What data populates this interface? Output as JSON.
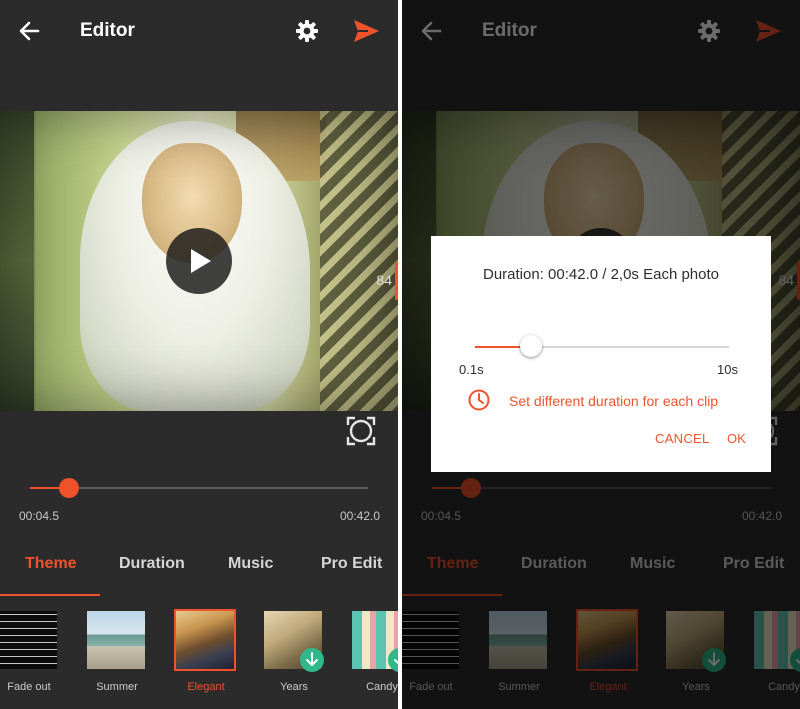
{
  "app": {
    "title": "Editor",
    "accent_color": "#f0522b",
    "background_color": "#2b2b2b",
    "icons": {
      "back": "arrow-left-icon",
      "settings": "gear-icon",
      "share": "send-icon",
      "play": "play-icon",
      "crop": "crop-frame-icon",
      "download": "download-icon",
      "clock": "clock-icon"
    }
  },
  "preview": {
    "side_counter": "84"
  },
  "timeline": {
    "current": "00:04.5",
    "total": "00:42.0",
    "progress": 0.115
  },
  "tabs": [
    {
      "label": "Theme",
      "active": true
    },
    {
      "label": "Duration",
      "active": false
    },
    {
      "label": "Music",
      "active": false
    },
    {
      "label": "Pro Edit",
      "active": false
    }
  ],
  "themes": [
    {
      "label": "Fade out",
      "selected": false,
      "downloadable": false
    },
    {
      "label": "Summer",
      "selected": false,
      "downloadable": false
    },
    {
      "label": "Elegant",
      "selected": true,
      "downloadable": false
    },
    {
      "label": "Years",
      "selected": false,
      "downloadable": true
    },
    {
      "label": "Candy",
      "selected": false,
      "downloadable": true
    }
  ],
  "dialog": {
    "title": "Duration: 00:42.0 / 2,0s Each photo",
    "slider_min": "0.1s",
    "slider_max": "10s",
    "slider_value": 0.22,
    "link_text": "Set different duration for each clip",
    "cancel_label": "CANCEL",
    "ok_label": "OK"
  }
}
